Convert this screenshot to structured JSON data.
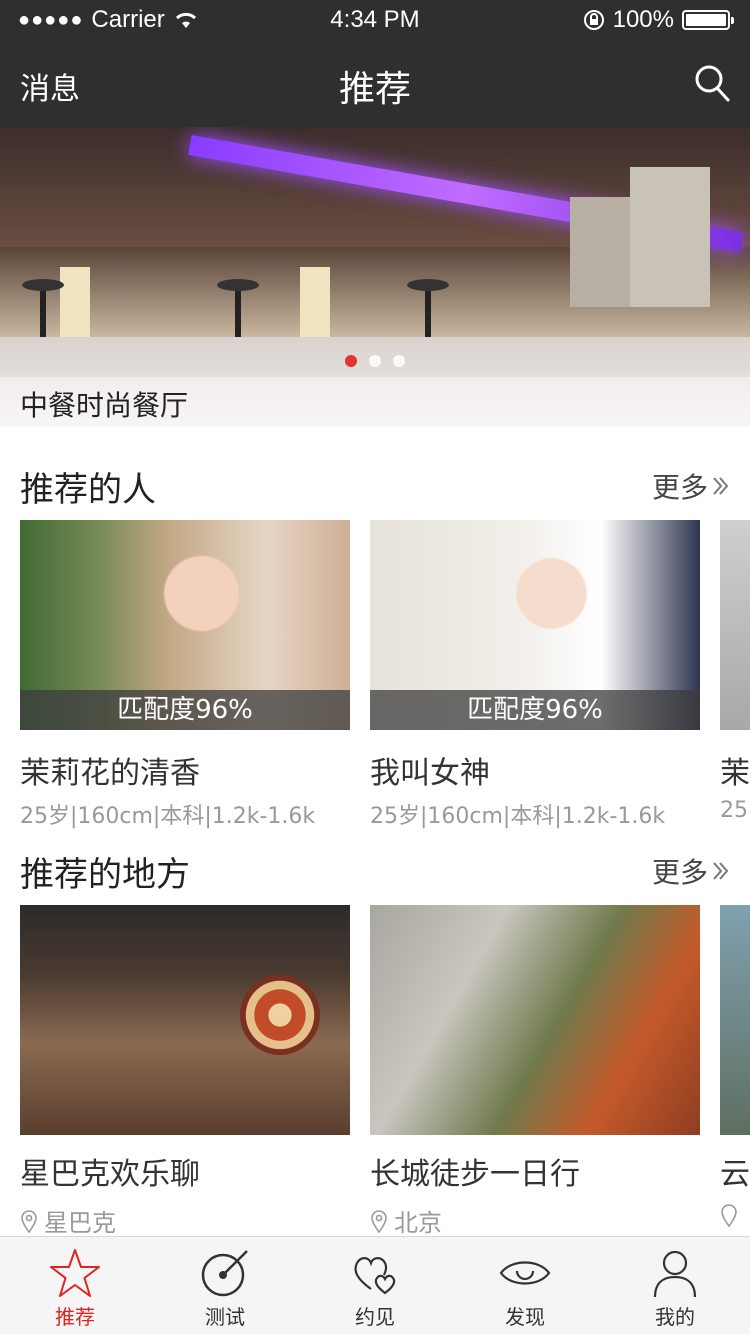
{
  "status_bar": {
    "carrier": "Carrier",
    "time": "4:34 PM",
    "battery": "100%"
  },
  "nav": {
    "left_label": "消息",
    "title": "推荐"
  },
  "banner": {
    "caption": "中餐时尚餐厅",
    "page_count": 3,
    "active_page": 1
  },
  "people": {
    "title": "推荐的人",
    "more": "更多",
    "items": [
      {
        "match": "匹配度96%",
        "name": "茉莉花的清香",
        "meta": "25岁|160cm|本科|1.2k-1.6k"
      },
      {
        "match": "匹配度96%",
        "name": "我叫女神",
        "meta": "25岁|160cm|本科|1.2k-1.6k"
      },
      {
        "name": "茉",
        "meta": "25"
      }
    ]
  },
  "places": {
    "title": "推荐的地方",
    "more": "更多",
    "items": [
      {
        "name": "星巴克欢乐聊",
        "location": "星巴克"
      },
      {
        "name": "长城徒步一日行",
        "location": "北京"
      },
      {
        "name": "云",
        "location": ""
      }
    ]
  },
  "tabs": [
    {
      "label": "推荐",
      "icon": "star-icon",
      "active": true
    },
    {
      "label": "测试",
      "icon": "gauge-icon",
      "active": false
    },
    {
      "label": "约见",
      "icon": "hearts-icon",
      "active": false
    },
    {
      "label": "发现",
      "icon": "eye-icon",
      "active": false
    },
    {
      "label": "我的",
      "icon": "person-icon",
      "active": false
    }
  ],
  "colors": {
    "nav_bg": "#2f2f2f",
    "accent": "#e02222",
    "tab_bg": "#f5f5f5"
  }
}
